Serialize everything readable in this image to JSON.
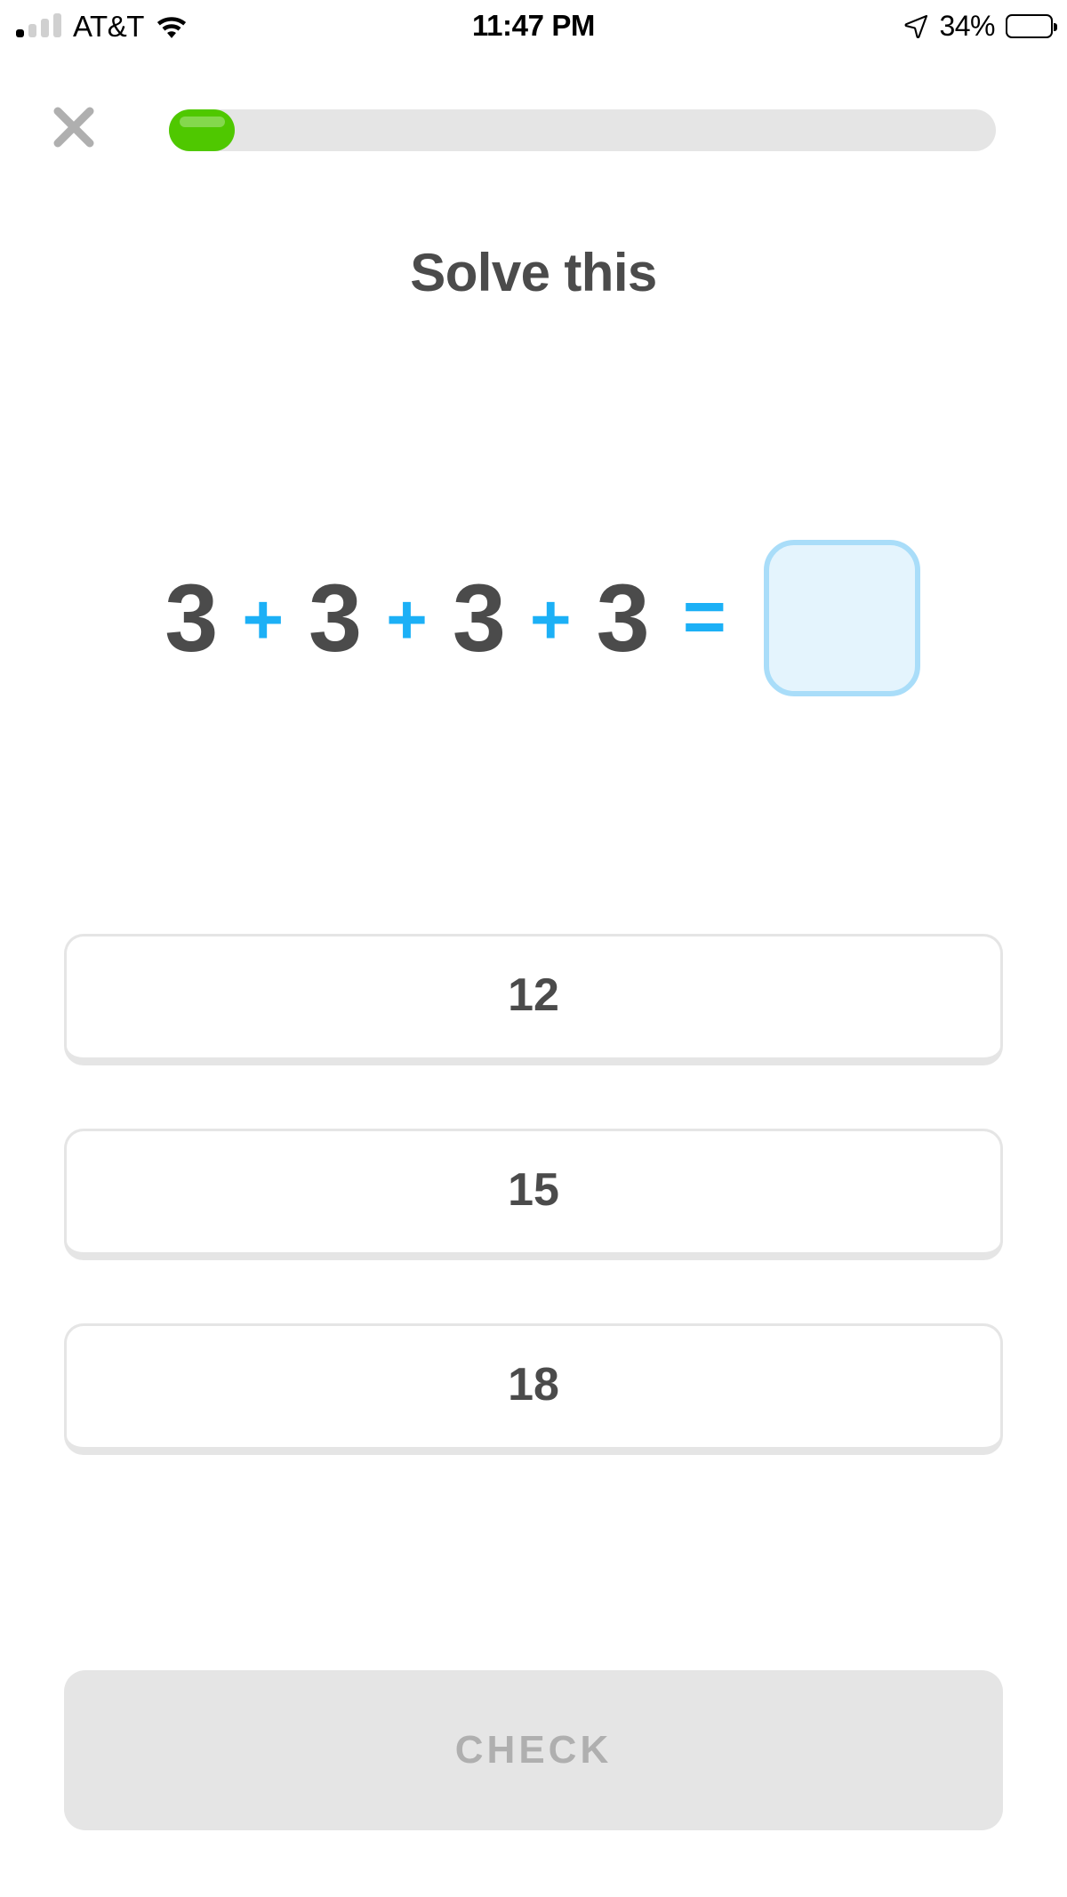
{
  "status_bar": {
    "carrier": "AT&T",
    "time": "11:47 PM",
    "battery_percent": "34%",
    "battery_level": 34,
    "signal_bars_total": 4,
    "signal_bars_filled": 1,
    "wifi_icon": "wifi-icon",
    "location_icon": "location-arrow-icon",
    "battery_icon": "battery-icon"
  },
  "top_bar": {
    "close_icon": "close-x-icon",
    "progress_percent": 8,
    "progress_fill_color": "#4fc800",
    "progress_track_color": "#e5e5e5"
  },
  "header": {
    "title": "Solve this"
  },
  "exercise": {
    "terms": [
      "3",
      "3",
      "3",
      "3"
    ],
    "operators": [
      "+",
      "+",
      "+"
    ],
    "equals": "=",
    "answer_box_value": "",
    "answer_box_placeholder": "",
    "accent_color": "#1cb0f6",
    "text_color": "#4b4b4b"
  },
  "options": [
    {
      "label": "12",
      "selected": false
    },
    {
      "label": "15",
      "selected": false
    },
    {
      "label": "18",
      "selected": false
    }
  ],
  "footer": {
    "check_label": "CHECK",
    "check_enabled": false,
    "check_bg_color": "#e5e5e5",
    "check_text_color": "#afafaf"
  }
}
